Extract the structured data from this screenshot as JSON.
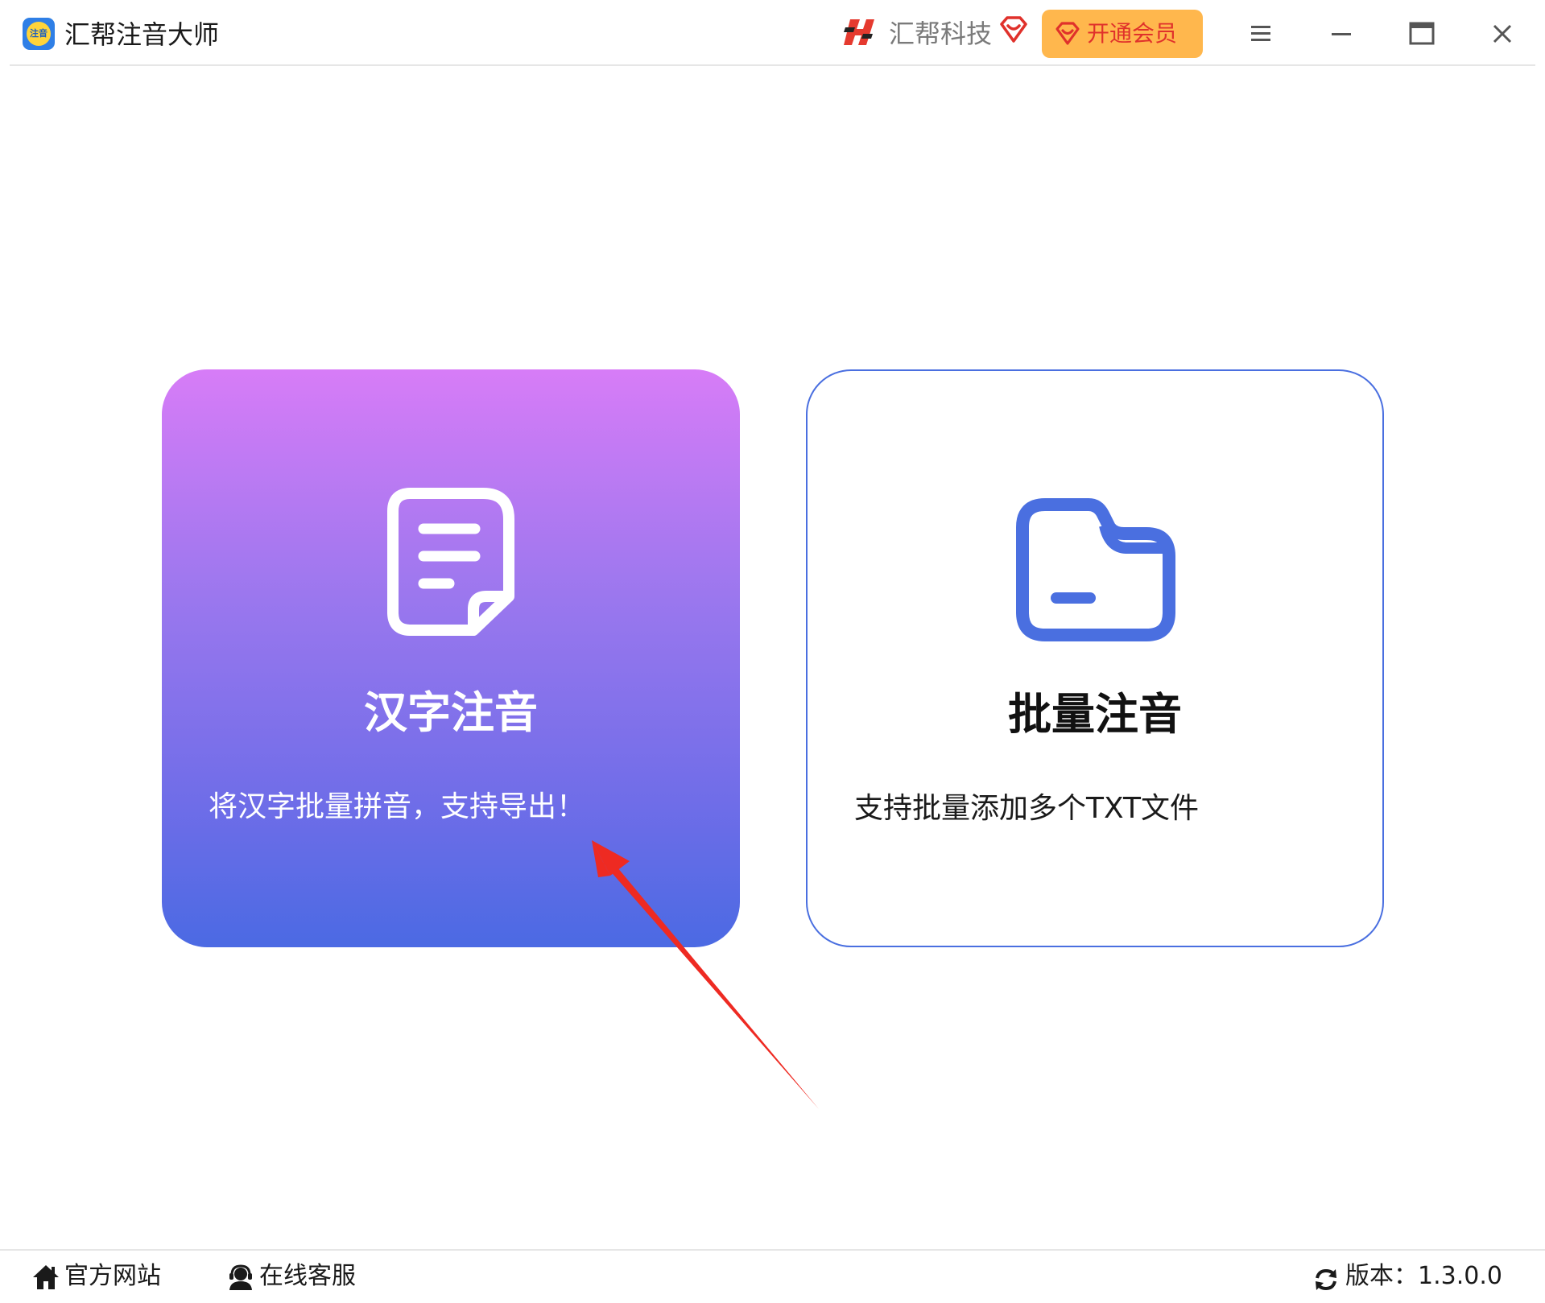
{
  "titlebar": {
    "app_title": "汇帮注音大师",
    "app_logo_text": "注音",
    "app_logo_icon": "pinyin-app-logo",
    "brand_name": "汇帮科技",
    "brand_logo_icon": "huibang-brand-logo",
    "vip_icon": "diamond-heart-icon",
    "vip_button_label": "开通会员",
    "menu_icon": "hamburger-menu-icon",
    "minimize_icon": "minimize-icon",
    "maximize_icon": "maximize-icon",
    "close_icon": "close-icon"
  },
  "cards": [
    {
      "id": "hanzi",
      "icon": "document-icon",
      "title": "汉字注音",
      "description": "将汉字批量拼音，支持导出！"
    },
    {
      "id": "batch",
      "icon": "folder-icon",
      "title": "批量注音",
      "description": "支持批量添加多个TXT文件"
    }
  ],
  "footer": {
    "website_label": "官方网站",
    "website_icon": "home-icon",
    "support_label": "在线客服",
    "support_icon": "headset-user-icon",
    "version_label": "版本：1.3.0.0",
    "version_icon": "refresh-icon"
  },
  "colors": {
    "accent_blue": "#4a6fe0",
    "vip_orange": "#ffb74d",
    "vip_text_red": "#e0312b",
    "gradient_top": "#d77cf7",
    "gradient_bottom": "#4b6ae3",
    "annotation_arrow": "#ee2a22"
  }
}
